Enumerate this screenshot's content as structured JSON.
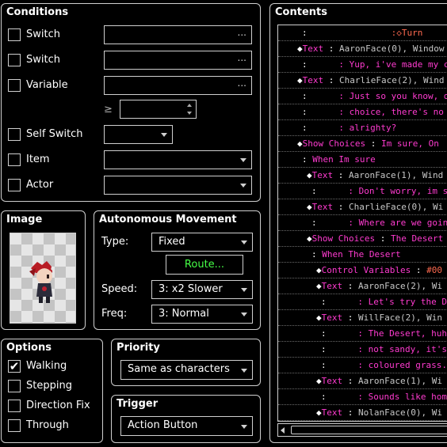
{
  "conditions": {
    "title": "Conditions",
    "rows": [
      {
        "label": "Switch",
        "checked": false,
        "value": "",
        "icon": "ellipsis"
      },
      {
        "label": "Switch",
        "checked": false,
        "value": "",
        "icon": "ellipsis"
      },
      {
        "label": "Variable",
        "checked": false,
        "value": "",
        "icon": "ellipsis"
      }
    ],
    "compare_symbol": "≥",
    "compare_value": "",
    "self_switch": {
      "label": "Self Switch",
      "checked": false,
      "value": ""
    },
    "item": {
      "label": "Item",
      "checked": false,
      "value": ""
    },
    "actor": {
      "label": "Actor",
      "checked": false,
      "value": ""
    },
    "ellipsis": "..."
  },
  "image": {
    "title": "Image"
  },
  "autonomous": {
    "title": "Autonomous Movement",
    "type_label": "Type:",
    "type_value": "Fixed",
    "route_button": "Route...",
    "speed_label": "Speed:",
    "speed_value": "3: x2 Slower",
    "freq_label": "Freq:",
    "freq_value": "3: Normal"
  },
  "options": {
    "title": "Options",
    "items": [
      {
        "label": "Walking",
        "checked": true
      },
      {
        "label": "Stepping",
        "checked": false
      },
      {
        "label": "Direction Fix",
        "checked": false
      },
      {
        "label": "Through",
        "checked": false
      }
    ]
  },
  "priority": {
    "title": "Priority",
    "value": "Same as characters"
  },
  "trigger": {
    "title": "Trigger",
    "value": "Action Button"
  },
  "contents": {
    "title": "Contents",
    "rows": [
      {
        "indent": 0,
        "bullet": false,
        "parts": [
          [
            "c-white",
            ":                "
          ],
          [
            "c-red",
            ":◇Turn"
          ]
        ]
      },
      {
        "indent": 0,
        "bullet": true,
        "parts": [
          [
            "c-pink",
            "Text"
          ],
          [
            "c-white",
            " : "
          ],
          [
            "c-gray",
            "AaronFace(0), Window"
          ]
        ]
      },
      {
        "indent": 0,
        "bullet": false,
        "parts": [
          [
            "c-white",
            ":      "
          ],
          [
            "c-pink",
            ": Yup, i've made my ch"
          ]
        ]
      },
      {
        "indent": 0,
        "bullet": true,
        "parts": [
          [
            "c-pink",
            "Text"
          ],
          [
            "c-white",
            " : "
          ],
          [
            "c-gray",
            "CharlieFace(2), Wind"
          ]
        ]
      },
      {
        "indent": 0,
        "bullet": false,
        "parts": [
          [
            "c-white",
            ":      "
          ],
          [
            "c-pink",
            ": Just so you know, on"
          ]
        ]
      },
      {
        "indent": 0,
        "bullet": false,
        "parts": [
          [
            "c-white",
            ":      "
          ],
          [
            "c-pink",
            ": choice, there's no g"
          ]
        ]
      },
      {
        "indent": 0,
        "bullet": false,
        "parts": [
          [
            "c-white",
            ":      "
          ],
          [
            "c-pink",
            ": alrighty?"
          ]
        ]
      },
      {
        "indent": 0,
        "bullet": true,
        "parts": [
          [
            "c-pink",
            "Show Choices"
          ],
          [
            "c-white",
            " : "
          ],
          [
            "c-pink",
            "Im sure, On"
          ]
        ]
      },
      {
        "indent": 0,
        "bullet": false,
        "parts": [
          [
            "c-white",
            ": "
          ],
          [
            "c-pink",
            "When Im sure"
          ]
        ]
      },
      {
        "indent": 1,
        "bullet": true,
        "parts": [
          [
            "c-pink",
            "Text"
          ],
          [
            "c-white",
            " : "
          ],
          [
            "c-gray",
            "AaronFace(1), Wind"
          ]
        ]
      },
      {
        "indent": 1,
        "bullet": false,
        "parts": [
          [
            "c-white",
            ":      "
          ],
          [
            "c-pink",
            ": Don't worry, im su"
          ]
        ]
      },
      {
        "indent": 1,
        "bullet": true,
        "parts": [
          [
            "c-pink",
            "Text"
          ],
          [
            "c-white",
            " : "
          ],
          [
            "c-gray",
            "CharlieFace(0), Wi"
          ]
        ]
      },
      {
        "indent": 1,
        "bullet": false,
        "parts": [
          [
            "c-white",
            ":      "
          ],
          [
            "c-pink",
            ": Where are we going"
          ]
        ]
      },
      {
        "indent": 1,
        "bullet": true,
        "parts": [
          [
            "c-pink",
            "Show Choices"
          ],
          [
            "c-white",
            " : "
          ],
          [
            "c-pink",
            "The Desert"
          ]
        ]
      },
      {
        "indent": 1,
        "bullet": false,
        "parts": [
          [
            "c-white",
            ": "
          ],
          [
            "c-pink",
            "When The Desert"
          ]
        ]
      },
      {
        "indent": 2,
        "bullet": true,
        "parts": [
          [
            "c-pink",
            "Control Variables"
          ],
          [
            "c-white",
            " : "
          ],
          [
            "c-red",
            "#00"
          ]
        ]
      },
      {
        "indent": 2,
        "bullet": true,
        "parts": [
          [
            "c-pink",
            "Text"
          ],
          [
            "c-white",
            " : "
          ],
          [
            "c-gray",
            "AaronFace(2), Wi"
          ]
        ]
      },
      {
        "indent": 2,
        "bullet": false,
        "parts": [
          [
            "c-white",
            ":      "
          ],
          [
            "c-pink",
            ": Let's try the De"
          ]
        ]
      },
      {
        "indent": 2,
        "bullet": true,
        "parts": [
          [
            "c-pink",
            "Text"
          ],
          [
            "c-white",
            " : "
          ],
          [
            "c-gray",
            "WillFace(2), Win"
          ]
        ]
      },
      {
        "indent": 2,
        "bullet": false,
        "parts": [
          [
            "c-white",
            ":      "
          ],
          [
            "c-pink",
            ": The Desert, huh?"
          ]
        ]
      },
      {
        "indent": 2,
        "bullet": false,
        "parts": [
          [
            "c-white",
            ":      "
          ],
          [
            "c-pink",
            ": not sandy, it's"
          ]
        ]
      },
      {
        "indent": 2,
        "bullet": false,
        "parts": [
          [
            "c-white",
            ":      "
          ],
          [
            "c-pink",
            ": coloured grass."
          ]
        ]
      },
      {
        "indent": 2,
        "bullet": true,
        "parts": [
          [
            "c-pink",
            "Text"
          ],
          [
            "c-white",
            " : "
          ],
          [
            "c-gray",
            "AaronFace(1), Wi"
          ]
        ]
      },
      {
        "indent": 2,
        "bullet": false,
        "parts": [
          [
            "c-white",
            ":      "
          ],
          [
            "c-pink",
            ": Sounds like home"
          ]
        ]
      },
      {
        "indent": 2,
        "bullet": true,
        "parts": [
          [
            "c-pink",
            "Text"
          ],
          [
            "c-white",
            " : "
          ],
          [
            "c-gray",
            "NolanFace(0), Wi"
          ]
        ]
      }
    ]
  },
  "colors": {
    "accent_green": "#46ff46",
    "command_pink": "#ff3bd0",
    "border": "#cfcfcf"
  }
}
